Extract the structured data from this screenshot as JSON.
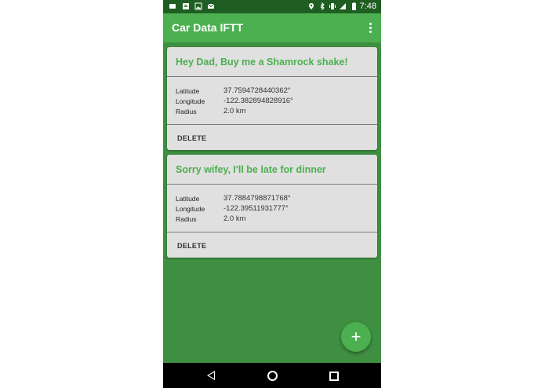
{
  "status_bar": {
    "time": "7:48"
  },
  "app_bar": {
    "title": "Car Data IFTT"
  },
  "cards": [
    {
      "title": "Hey Dad, Buy me a Shamrock shake!",
      "rows": [
        {
          "label": "Latitude",
          "value": "37.7594728440362°"
        },
        {
          "label": "Longitude",
          "value": "-122.382894828916°"
        },
        {
          "label": "Radius",
          "value": "2.0 km"
        }
      ],
      "action": "DELETE"
    },
    {
      "title": "Sorry wifey, I'll be late for dinner",
      "rows": [
        {
          "label": "Latitude",
          "value": "37.7884798871768°"
        },
        {
          "label": "Longitude",
          "value": "-122.39511931777°"
        },
        {
          "label": "Radius",
          "value": "2.0 km"
        }
      ],
      "action": "DELETE"
    }
  ],
  "fab": {
    "icon": "plus-icon",
    "glyph": "+"
  },
  "colors": {
    "primary": "#4caf50",
    "primary_dark": "#1f5e22",
    "background": "#3f8f42",
    "card": "#e0e0e0"
  }
}
